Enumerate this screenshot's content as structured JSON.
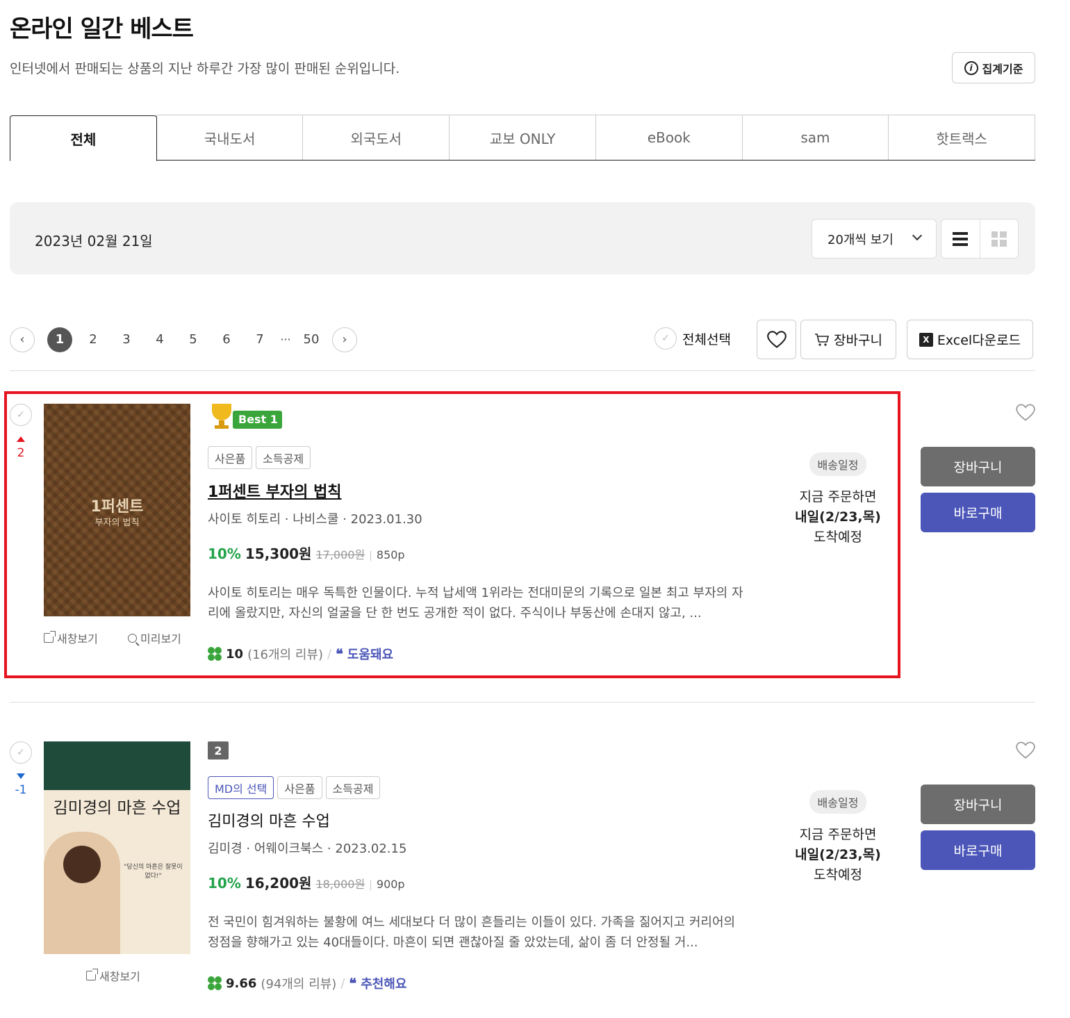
{
  "header": {
    "title": "온라인 일간 베스트",
    "description": "인터넷에서 판매되는 상품의 지난 하루간 가장 많이 판매된 순위입니다.",
    "criteria_button": "집계기준"
  },
  "tabs": [
    {
      "label": "전체",
      "active": true
    },
    {
      "label": "국내도서",
      "active": false
    },
    {
      "label": "외국도서",
      "active": false
    },
    {
      "label": "교보 ONLY",
      "active": false
    },
    {
      "label": "eBook",
      "active": false
    },
    {
      "label": "sam",
      "active": false
    },
    {
      "label": "핫트랙스",
      "active": false
    }
  ],
  "toolbar": {
    "date": "2023년 02월 21일",
    "per_page": "20개씩 보기",
    "view_mode": "list"
  },
  "pagination": {
    "current": "1",
    "pages": [
      "2",
      "3",
      "4",
      "5",
      "6",
      "7"
    ],
    "ellipsis": "···",
    "last": "50"
  },
  "actions": {
    "select_all": "전체선택",
    "cart": "장바구니",
    "excel": "Excel다운로드"
  },
  "books": [
    {
      "rank_change": "2",
      "rank_direction": "up",
      "badge": "Best 1",
      "tags": [
        "사은품",
        "소득공제"
      ],
      "title": "1퍼센트 부자의 법칙",
      "meta": "사이토 히토리 · 나비스쿨 · 2023.01.30",
      "discount": "10%",
      "price": "15,300원",
      "original_price": "17,000원",
      "points": "850p",
      "description": "사이토 히토리는 매우 독특한 인물이다. 누적 납세액 1위라는 전대미문의 기록으로 일본 최고 부자의 자리에 올랐지만, 자신의 얼굴을 단 한 번도 공개한 적이 없다. 주식이나 부동산에 손대지 않고, ...",
      "rating": "10",
      "review_count": "(16개의 리뷰)",
      "review_tag": "도움돼요",
      "cover_title": "1퍼센트",
      "cover_subtitle": "부자의 법칙",
      "links": {
        "new_window": "새창보기",
        "preview": "미리보기"
      },
      "delivery": {
        "label": "배송일정",
        "line1": "지금 주문하면",
        "line2": "내일(2/23,목)",
        "line3": "도착예정"
      },
      "cart_button": "장바구니",
      "buy_button": "바로구매"
    },
    {
      "rank_change": "-1",
      "rank_direction": "down",
      "badge": "2",
      "tags": [
        "MD의 선택",
        "사은품",
        "소득공제"
      ],
      "title": "김미경의 마흔 수업",
      "meta": "김미경 · 어웨이크북스 · 2023.02.15",
      "discount": "10%",
      "price": "16,200원",
      "original_price": "18,000원",
      "points": "900p",
      "description": "전 국민이 힘겨워하는 불황에 여느 세대보다 더 많이 흔들리는 이들이 있다. 가족을 짊어지고 커리어의 정점을 향해가고 있는 40대들이다. 마흔이 되면 괜찮아질 줄 았았는데, 삶이 좀 더 안정될 거...",
      "rating": "9.66",
      "review_count": "(94개의 리뷰)",
      "review_tag": "추천해요",
      "cover_title": "김미경의 마흔 수업",
      "cover_quote": "\"당신의 마흔은 잘못이 없다!\"",
      "links": {
        "new_window": "새창보기"
      },
      "delivery": {
        "label": "배송일정",
        "line1": "지금 주문하면",
        "line2": "내일(2/23,목)",
        "line3": "도착예정"
      },
      "cart_button": "장바구니",
      "buy_button": "바로구매"
    }
  ],
  "colors": {
    "highlight": "#e5141f",
    "buy": "#4b56b8",
    "cart": "#6d6d6d",
    "discount": "#22a34a"
  }
}
